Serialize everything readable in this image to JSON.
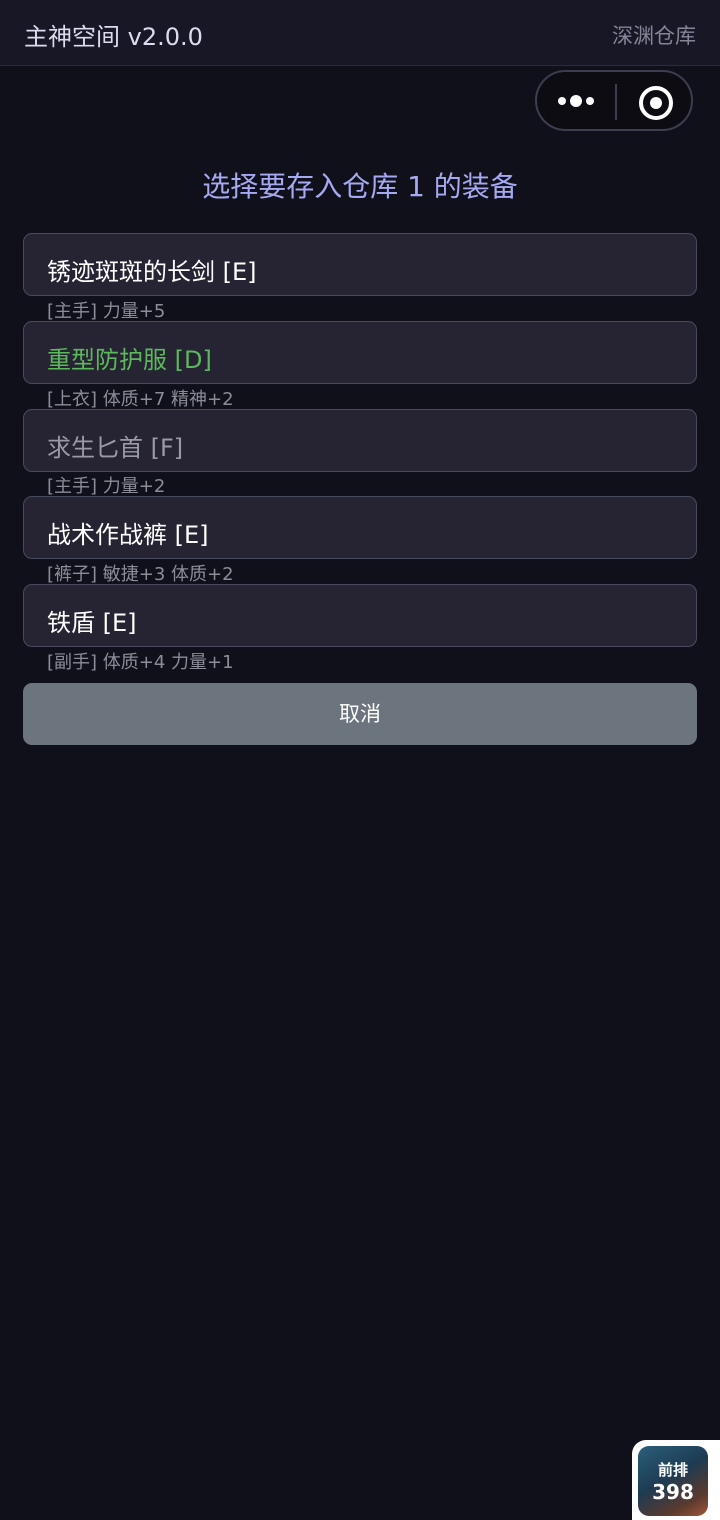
{
  "header": {
    "app_title": "主神空间 v2.0.0",
    "link_label": "深渊仓库"
  },
  "capsule": {
    "more_icon": "more-dots-icon",
    "close_icon": "target-circle-icon"
  },
  "prompt": {
    "title": "选择要存入仓库 1 的装备"
  },
  "items": [
    {
      "name": "锈迹斑斑的长剑 [E]",
      "stats": "[主手] 力量+5",
      "color": "#ffffff"
    },
    {
      "name": "重型防护服 [D]",
      "stats": "[上衣] 体质+7 精神+2",
      "color": "#5cb85c"
    },
    {
      "name": "求生匕首 [F]",
      "stats": "[主手] 力量+2",
      "color": "#9a9aa6"
    },
    {
      "name": "战术作战裤 [E]",
      "stats": "[裤子] 敏捷+3 体质+2",
      "color": "#ffffff"
    },
    {
      "name": "铁盾 [E]",
      "stats": "[副手] 体质+4 力量+1",
      "color": "#ffffff"
    }
  ],
  "actions": {
    "cancel_label": "取消"
  },
  "rank_widget": {
    "label": "前排",
    "value": "398"
  }
}
